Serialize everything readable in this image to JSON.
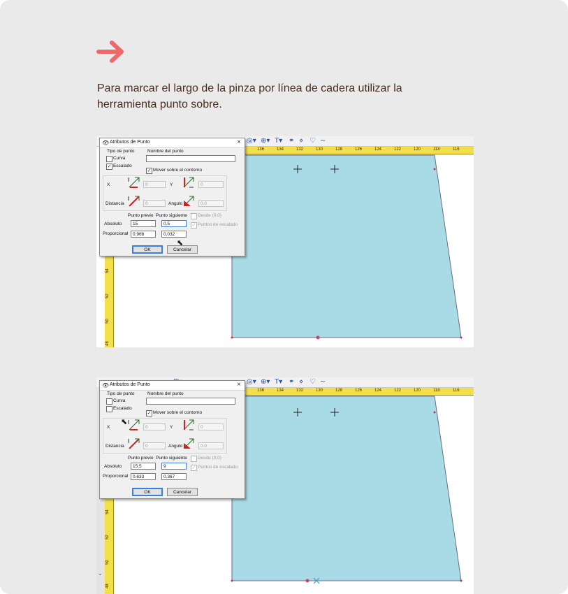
{
  "colors": {
    "arrow": "#ee6a6a",
    "instruction_text": "#4a2b1e",
    "pattern_fill": "#a9dbe6",
    "ruler": "#f3df4a"
  },
  "instruction": "Para marcar el largo de la pinza por línea de cadera utilizar la herramienta punto sobre.",
  "ruler_top_labels": [
    "138",
    "136",
    "134",
    "132",
    "130",
    "128",
    "126",
    "124",
    "122",
    "120",
    "118",
    "116"
  ],
  "ruler_left_labels": [
    "54",
    "52",
    "50",
    "48"
  ],
  "screens": [
    {
      "dialog": {
        "title": "Atributos de Punto",
        "close": "×",
        "tipo_de_punto": "Tipo de punto",
        "curva": "Curva",
        "escalado": "Escalado",
        "escalado_checked": "✓",
        "nombre_del_punto": "Nombre del punto",
        "nombre_value": "",
        "mover_sobre_contorno": "Mover sobre el contorno",
        "mover_checked": "✓",
        "x_label": "X",
        "x_value": "0",
        "y_label": "Y",
        "y_value": "0",
        "distancia_label": "Distancia",
        "distancia_value": "0",
        "angulo_label": "Angulo",
        "angulo_value": "0.0",
        "punto_previo": "Punto previo",
        "punto_siguiente": "Punto siguiente",
        "absoluto": "Absoluto",
        "proporcional": "Proporcional",
        "absoluto_previo": "15",
        "absoluto_siguiente": "0.5",
        "proporcional_previo": "0.968",
        "proporcional_siguiente": "0.032",
        "desde_00": "Desde (0,0)",
        "puntos_de_escalado": "Puntos de escalado",
        "ok": "OK",
        "cancelar": "Cancelar"
      }
    },
    {
      "dialog": {
        "title": "Atributos de Punto",
        "close": "×",
        "tipo_de_punto": "Tipo de punto",
        "curva": "Curva",
        "escalado": "Escalado",
        "escalado_checked": "",
        "nombre_del_punto": "Nombre del punto",
        "nombre_value": "",
        "mover_sobre_contorno": "Mover sobre el contorno",
        "mover_checked": "✓",
        "x_label": "X",
        "x_value": "0",
        "y_label": "Y",
        "y_value": "0",
        "distancia_label": "Distancia",
        "distancia_value": "0",
        "angulo_label": "Angulo",
        "angulo_value": "0.0",
        "punto_previo": "Punto previo",
        "punto_siguiente": "Punto siguiente",
        "absoluto": "Absoluto",
        "proporcional": "Proporcional",
        "absoluto_previo": "15.5",
        "absoluto_siguiente": "9",
        "proporcional_previo": "0.633",
        "proporcional_siguiente": "0.367",
        "desde_00": "Desde (0,0)",
        "puntos_de_escalado": "Puntos de escalado",
        "ok": "OK",
        "cancelar": "Cancelar"
      }
    }
  ]
}
